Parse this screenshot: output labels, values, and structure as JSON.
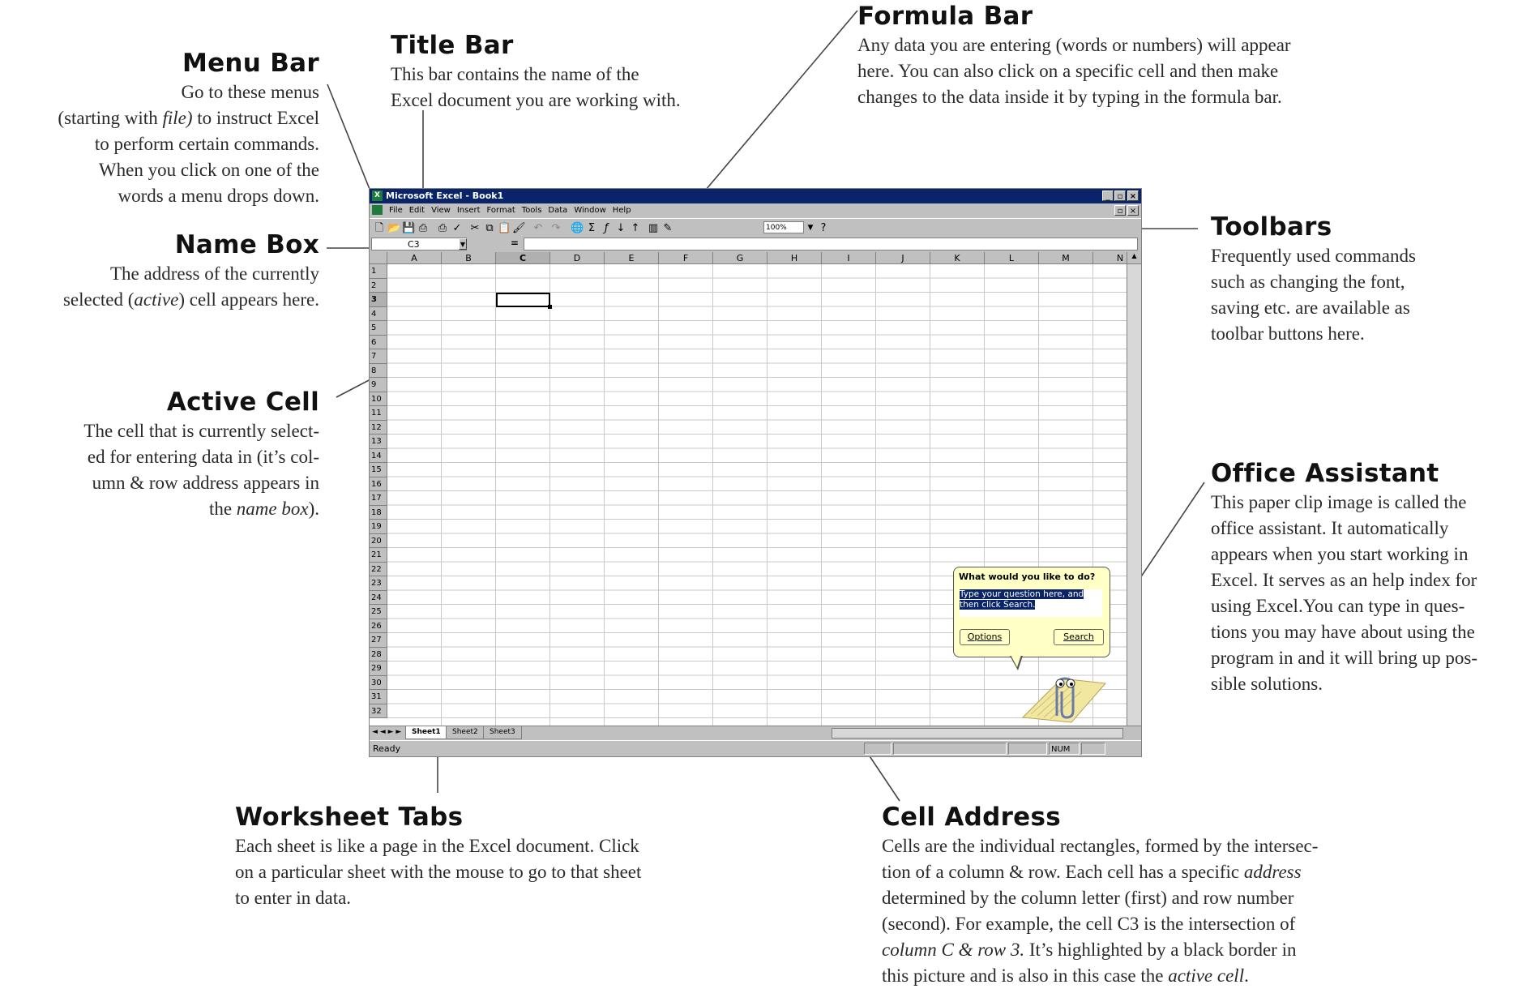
{
  "annotations": {
    "menu_bar": {
      "title": "Menu Bar",
      "text_1": "Go to these menus",
      "text_2a": "(starting with ",
      "text_2b": "file)",
      "text_2c": " to instruct Excel",
      "text_3": "to perform certain commands.",
      "text_4": "When you click on one of the",
      "text_5": "words a menu drops down."
    },
    "title_bar": {
      "title": "Title Bar",
      "text_1": "This bar contains the name of the",
      "text_2": "Excel document you are working with."
    },
    "formula_bar": {
      "title": "Formula Bar",
      "text_1": "Any data you are entering (words or numbers) will appear",
      "text_2": "here. You can also click on a specific cell and then make",
      "text_3": "changes to the data inside it by typing in the formula bar."
    },
    "name_box": {
      "title": "Name Box",
      "text_1": "The address of the currently",
      "text_2a": "selected (",
      "text_2b": "active",
      "text_2c": ") cell appears here."
    },
    "toolbars": {
      "title": "Toolbars",
      "text_1": "Frequently used commands",
      "text_2": "such as changing the font,",
      "text_3": "saving etc. are available as",
      "text_4": "toolbar buttons here."
    },
    "active_cell": {
      "title": "Active Cell",
      "text_1": "The cell that is currently select-",
      "text_2": "ed for entering data in (it’s col-",
      "text_3": "umn & row address appears in",
      "text_4a": "the ",
      "text_4b": "name box",
      "text_4c": ")."
    },
    "office_assistant": {
      "title": "Office Assistant",
      "text_1": "This paper clip image is called the",
      "text_2": "office assistant. It automatically",
      "text_3": "appears when you start working in",
      "text_4": "Excel. It serves as an help index for",
      "text_5": "using Excel.You can type in ques-",
      "text_6": "tions you may have about using the",
      "text_7": "program in and it will bring up pos-",
      "text_8": "sible solutions."
    },
    "worksheet_tabs": {
      "title": "Worksheet Tabs",
      "text_1": "Each sheet is like a page in the Excel document. Click",
      "text_2": "on a particular sheet with the mouse to go to that sheet",
      "text_3": "to enter in data."
    },
    "cell_address": {
      "title": "Cell Address",
      "text_1": "Cells are the individual rectangles, formed by the intersec-",
      "text_2a": "tion of a column & row. Each cell has a specific ",
      "text_2b": "address",
      "text_3": "determined by the column letter (first) and row number",
      "text_4": "(second). For example, the cell C3 is the intersection of",
      "text_5a": "column C & row 3.",
      "text_5b": " It’s highlighted by a black border in",
      "text_6a": "this picture and is also in this case the ",
      "text_6b": "active cell",
      "text_6c": "."
    }
  },
  "excel": {
    "window_title": "Microsoft Excel - Book1",
    "window_buttons": [
      "_",
      "▫",
      "×"
    ],
    "menus": [
      "File",
      "Edit",
      "View",
      "Insert",
      "Format",
      "Tools",
      "Data",
      "Window",
      "Help"
    ],
    "toolbar_icons": [
      "new-icon",
      "open-icon",
      "save-icon",
      "print-icon",
      "print-preview-icon",
      "spelling-icon",
      "cut-icon",
      "copy-icon",
      "paste-icon",
      "format-painter-icon",
      "undo-icon",
      "redo-icon",
      "hyperlink-icon",
      "autosum-icon",
      "function-icon",
      "sort-ascending-icon",
      "sort-descending-icon",
      "chart-wizard-icon",
      "drawing-icon",
      "help-icon"
    ],
    "zoom": "100%",
    "name_box": "C3",
    "name_box_arrow": "▼",
    "formula_equals": "=",
    "formula_value": "",
    "columns": [
      "A",
      "B",
      "C",
      "D",
      "E",
      "F",
      "G",
      "H",
      "I",
      "J",
      "K",
      "L",
      "M",
      "N"
    ],
    "rows": [
      "1",
      "2",
      "3",
      "4",
      "5",
      "6",
      "7",
      "8",
      "9",
      "10",
      "11",
      "12",
      "13",
      "14",
      "15",
      "16",
      "17",
      "18",
      "19",
      "20",
      "21",
      "22",
      "23",
      "24",
      "25",
      "26",
      "27",
      "28",
      "29",
      "30",
      "31",
      "32"
    ],
    "selected_column": "C",
    "selected_row": "3",
    "tab_nav": "◄ ◄ ► ►",
    "sheets": [
      "Sheet1",
      "Sheet2",
      "Sheet3"
    ],
    "active_sheet": "Sheet1",
    "status": "Ready",
    "num_indicator": "NUM",
    "assistant": {
      "question": "What would you like to do?",
      "input_text": "Type your question here, and then click Search.",
      "options_label": "Options",
      "search_label": "Search"
    }
  }
}
